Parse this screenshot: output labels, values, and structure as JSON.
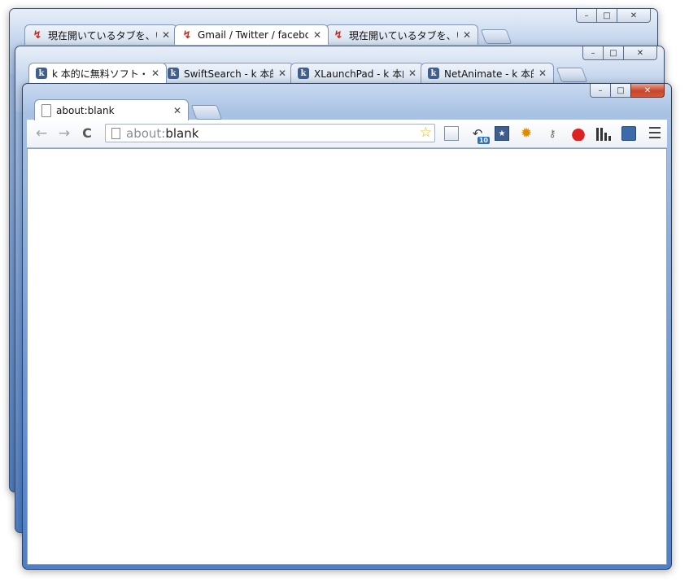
{
  "windows": {
    "back_top": {
      "controls": {
        "minimize": "–",
        "maximize": "□",
        "close": "✕"
      },
      "tabs": [
        {
          "title": "現在開いているタブを、いろいろ",
          "icon": "gmail-icon",
          "close": "✕"
        },
        {
          "title": "Gmail / Twitter / facebook",
          "icon": "gmail-icon",
          "close": "✕",
          "active": true
        },
        {
          "title": "現在開いているタブを、いろいろ",
          "icon": "gmail-icon",
          "close": "✕"
        }
      ]
    },
    "back_middle": {
      "controls": {
        "minimize": "–",
        "maximize": "□",
        "close": "✕"
      },
      "tabs": [
        {
          "title": "k 本的に無料ソフト・フリーソフト",
          "icon": "k-icon",
          "close": "✕",
          "active": true
        },
        {
          "title": "SwiftSearch - k 本的に",
          "icon": "k-icon",
          "close": "✕"
        },
        {
          "title": "XLaunchPad - k 本的に",
          "icon": "k-icon",
          "close": "✕"
        },
        {
          "title": "NetAnimate - k 本的に",
          "icon": "k-icon",
          "close": "✕"
        }
      ]
    },
    "front": {
      "controls": {
        "minimize": "–",
        "maximize": "□",
        "close": "✕"
      },
      "tabs": [
        {
          "title": "about:blank",
          "icon": "page-icon",
          "close": "✕",
          "active": true
        }
      ],
      "toolbar": {
        "back": "←",
        "forward": "→",
        "reload": "C",
        "url_scheme": "about:",
        "url_rest": "blank",
        "star": "☆",
        "extension_badge": "10",
        "bookmark_glyph": "★",
        "gear_glyph": "✹",
        "key_glyph": "⚷",
        "undo_glyph": "↶"
      }
    }
  }
}
